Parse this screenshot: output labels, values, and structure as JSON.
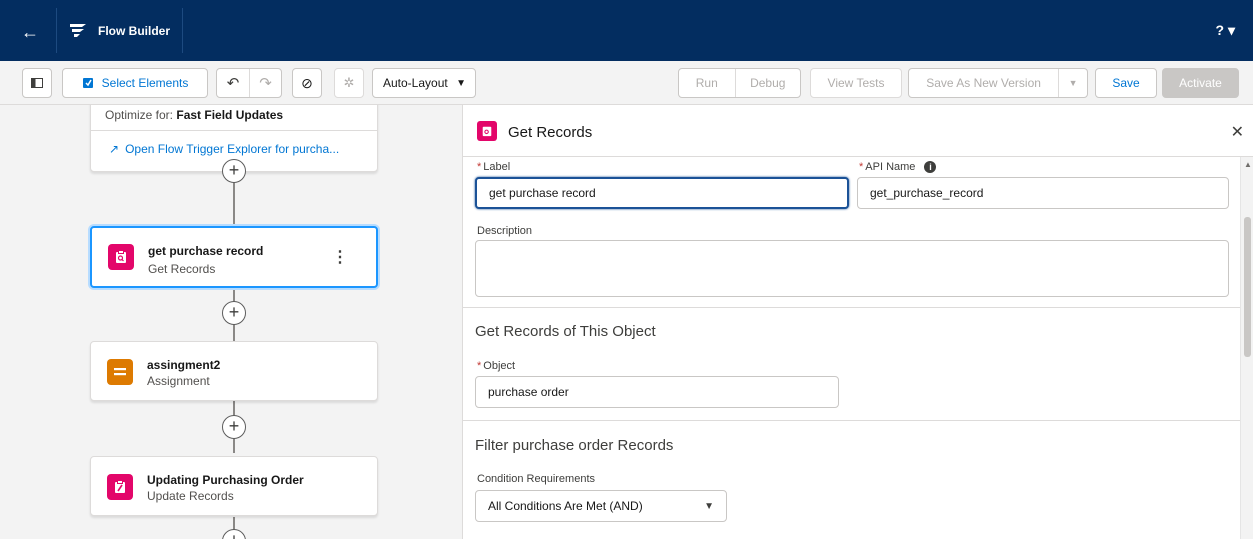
{
  "app": {
    "title": "Flow Builder",
    "help": "? ▾"
  },
  "toolbar": {
    "select_elements": "Select Elements",
    "auto_layout": "Auto-Layout",
    "run": "Run",
    "debug": "Debug",
    "view_tests": "View Tests",
    "save_as_new_version": "Save As New Version",
    "save": "Save",
    "activate": "Activate"
  },
  "canvas": {
    "start": {
      "optimize_label": "Optimize for:",
      "optimize_value": "Fast Field Updates",
      "trigger_link": "Open Flow Trigger Explorer for purcha..."
    },
    "nodes": [
      {
        "title": "get purchase record",
        "type": "Get Records",
        "icon": "get-records-icon",
        "color": "#e3066a"
      },
      {
        "title": "assingment2",
        "type": "Assignment",
        "icon": "assignment-icon",
        "color": "#dd7a01"
      },
      {
        "title": "Updating Purchasing Order",
        "type": "Update Records",
        "icon": "update-records-icon",
        "color": "#e3066a"
      }
    ]
  },
  "panel": {
    "title": "Get Records",
    "label_field": {
      "label": "Label",
      "value": "get purchase record"
    },
    "api_field": {
      "label": "API Name",
      "value": "get_purchase_record"
    },
    "description_field": {
      "label": "Description",
      "value": ""
    },
    "object_section": {
      "title": "Get Records of This Object",
      "object_label": "Object",
      "object_value": "purchase order"
    },
    "filter_section": {
      "title": "Filter purchase order Records",
      "condition_label": "Condition Requirements",
      "condition_value": "All Conditions Are Met (AND)"
    }
  }
}
